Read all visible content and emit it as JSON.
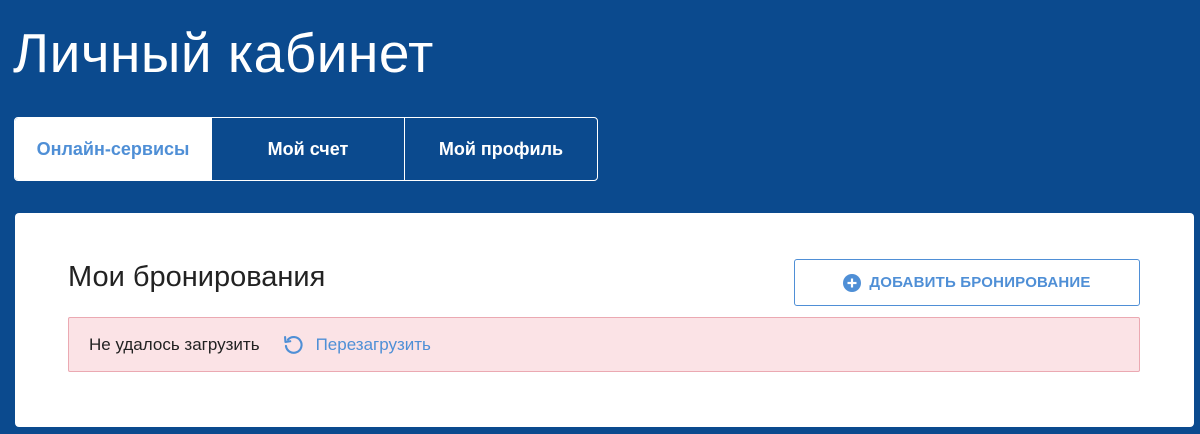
{
  "header": {
    "title": "Личный кабинет"
  },
  "tabs": [
    {
      "label": "Онлайн-сервисы",
      "active": true
    },
    {
      "label": "Мой счет",
      "active": false
    },
    {
      "label": "Мой профиль",
      "active": false
    }
  ],
  "bookings": {
    "title": "Мои бронирования",
    "add_button_label": "ДОБАВИТЬ БРОНИРОВАНИЕ",
    "add_button_icon": "plus-circle-icon",
    "error": {
      "message": "Не удалось загрузить",
      "reload_label": "Перезагрузить",
      "reload_icon": "reload-icon"
    }
  },
  "colors": {
    "header_background": "#0b4a8e",
    "accent": "#4f8fd6",
    "error_background": "#fbe3e6",
    "error_border": "#eba9b2"
  }
}
